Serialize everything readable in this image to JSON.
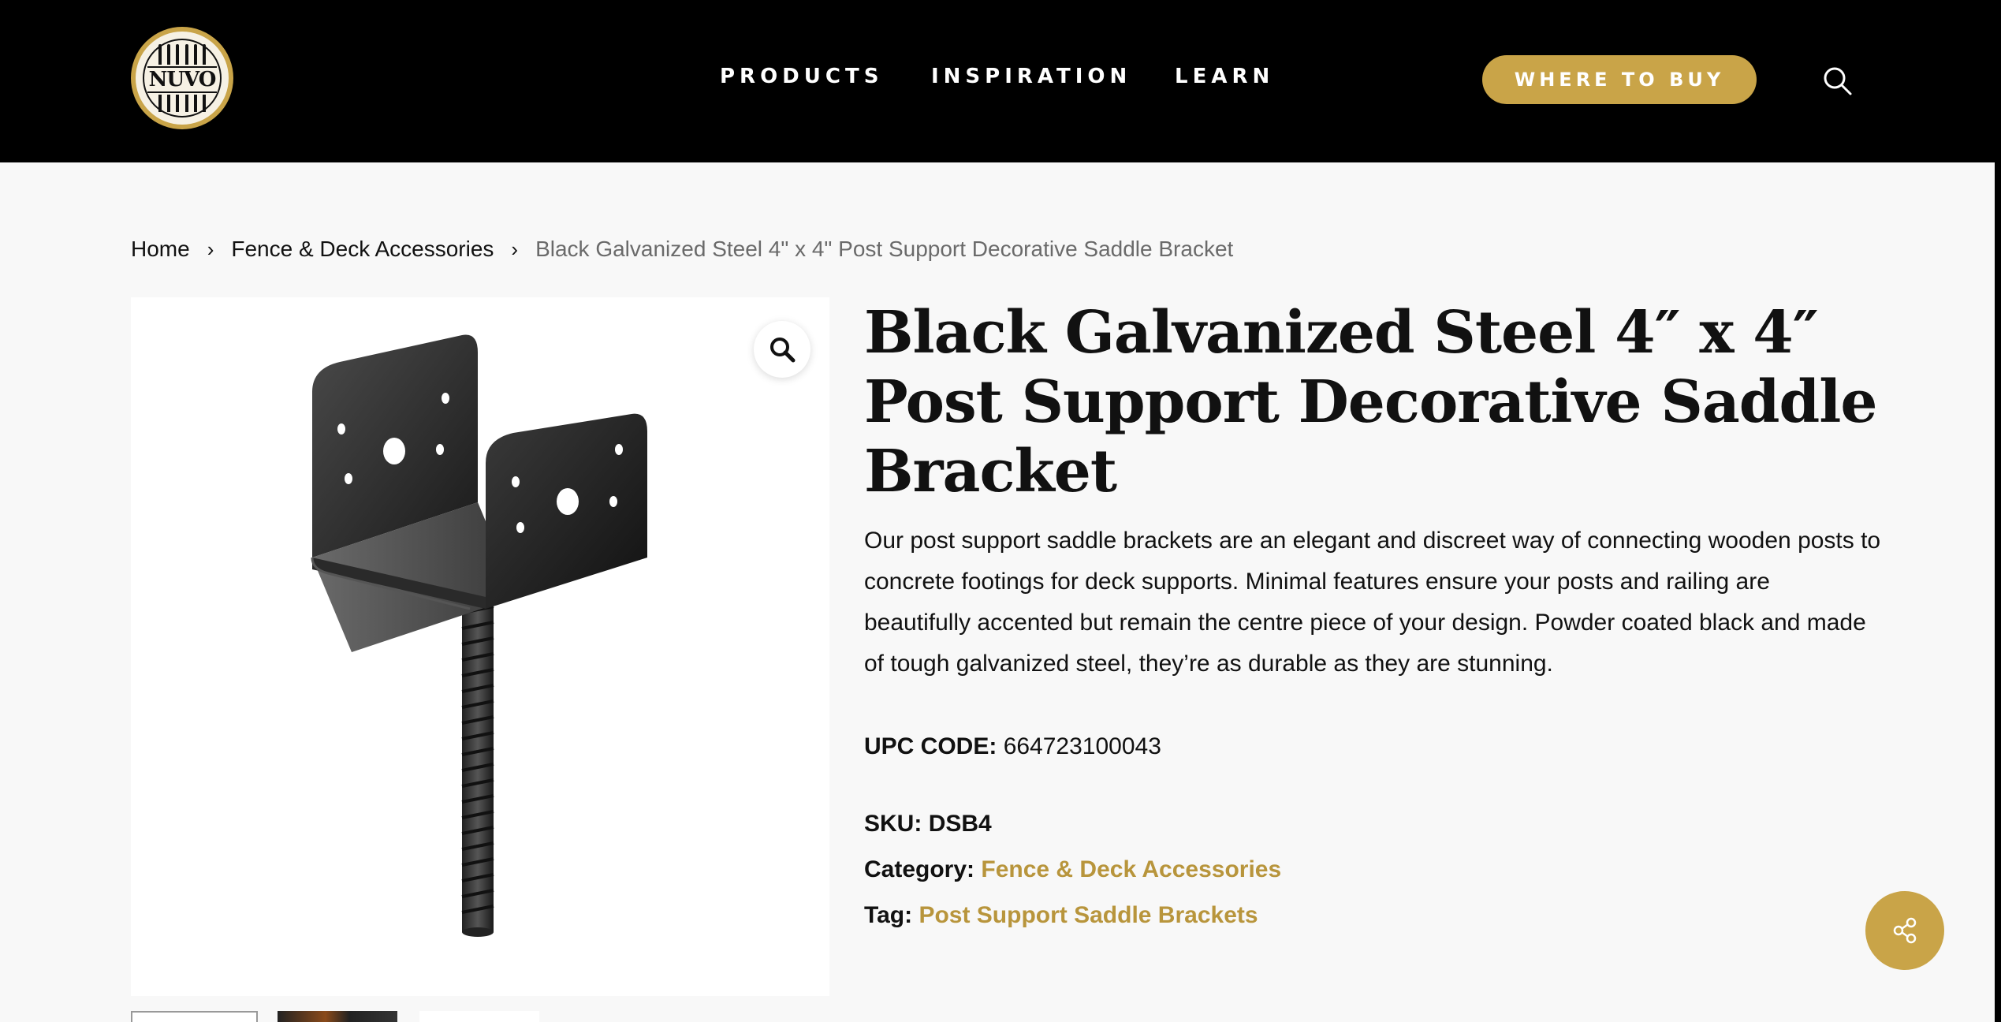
{
  "header": {
    "logo_text": "NUVO",
    "nav": [
      {
        "label": "PRODUCTS"
      },
      {
        "label": "INSPIRATION"
      },
      {
        "label": "LEARN"
      }
    ],
    "cta_label": "WHERE TO BUY",
    "search_icon": "search-icon",
    "colors": {
      "background": "#000000",
      "accent": "#c9a448"
    }
  },
  "breadcrumb": {
    "items": [
      {
        "label": "Home"
      },
      {
        "label": "Fence & Deck Accessories"
      }
    ],
    "current": "Black Galvanized Steel 4\" x 4\" Post Support Decorative Saddle Bracket"
  },
  "product": {
    "title": "Black Galvanized Steel 4″ x 4″ Post Support Decorative Saddle Bracket",
    "description": "Our post support saddle brackets are an elegant and discreet way of connecting wooden posts to concrete footings for deck supports. Minimal features ensure your posts and railing are beautifully accented but remain the centre piece of your design. Powder coated black and made of tough galvanized steel, they’re as durable as they are stunning.",
    "upc_label": "UPC CODE:",
    "upc_value": "664723100043",
    "sku_label": "SKU:",
    "sku_value": "DSB4",
    "category_label": "Category:",
    "category_value": "Fence & Deck Accessories",
    "tag_label": "Tag:",
    "tag_value": "Post Support Saddle Brackets",
    "zoom_icon": "magnifier-icon",
    "share_icon": "share-icon"
  }
}
